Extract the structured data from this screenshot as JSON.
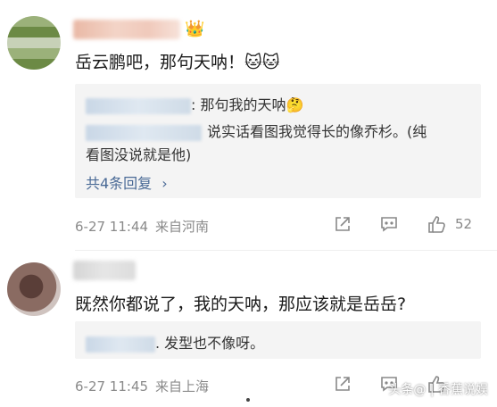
{
  "comments": [
    {
      "text": "岳云鹏吧，那句天呐！🐱🐱",
      "replies": [
        {
          "text": ": 那句我的天呐🤔"
        },
        {
          "text": "说实话看图我觉得长的像乔杉。(纯",
          "text2": "看图没说就是他)"
        }
      ],
      "more_label": "共4条回复",
      "time": "6-27 11:44",
      "location": "来自河南",
      "likes": "52"
    },
    {
      "text": "既然你都说了，我的天呐，那应该就是岳岳?",
      "replies": [
        {
          "text": ". 发型也不像呀。"
        }
      ],
      "time": "6-27 11:45",
      "location": "来自上海",
      "likes": ""
    }
  ],
  "watermark": "头条@ | 香蕉说娱",
  "icons": {
    "badge": "crown-icon",
    "share": "share-icon",
    "reply": "comment-icon",
    "like": "thumbs-up-icon"
  }
}
